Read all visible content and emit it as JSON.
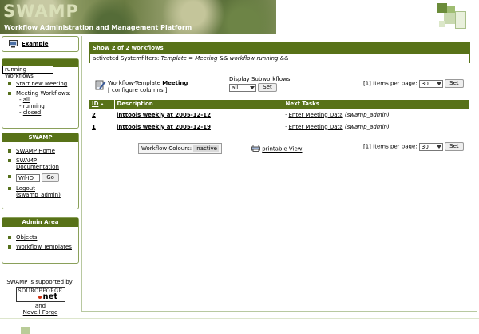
{
  "header": {
    "logo_text": "SWAMP",
    "title": "Workflow Administration and Management Platform"
  },
  "sidebar": {
    "example_link": "Example",
    "workflow_select": "running Workflows",
    "start_new_meeting": "Start new Meeting",
    "meeting_workflows_label": "Meeting Workflows:",
    "meeting_filters": [
      "all",
      "running",
      "closed"
    ],
    "swamp_section": {
      "title": "SWAMP",
      "home": "SWAMP Home",
      "documentation": "SWAMP Documentation",
      "wfid_placeholder": "Wf-ID",
      "go_label": "Go",
      "logout": "Logout (swamp_admin)"
    },
    "admin_section": {
      "title": "Admin Area",
      "objects": "Objects",
      "workflow_templates": "Workflow Templates"
    },
    "supported_by": "SWAMP is supported by:",
    "sourceforge_text": "SOURCEFORGE",
    "sourceforge_net": "net",
    "and_text": "and",
    "novell_forge": "Novell Forge"
  },
  "main": {
    "header_title": "Show 2 of 2 workflows",
    "filter_prefix": "activated Systemfilters:",
    "filter_value": "Template = Meeting && workflow running &&",
    "template_label": "Workflow-Template",
    "template_name": "Meeting",
    "configure_columns": "configure columns",
    "display_subworkflows_label": "Display Subworkflows:",
    "subworkflows_value": "all",
    "set_label": "Set",
    "page_indicator": "[1] Items per page:",
    "items_per_page": "30",
    "columns": [
      "ID",
      "Description",
      "Next Tasks"
    ],
    "rows": [
      {
        "id": "2",
        "description": "inttools weekly at 2005-12-12",
        "task": "Enter Meeting Data",
        "user": "(swamp_admin)"
      },
      {
        "id": "1",
        "description": "inttools weekly at 2005-12-19",
        "task": "Enter Meeting Data",
        "user": "(swamp_admin)"
      }
    ],
    "workflow_colours_label": "Workflow Colours:",
    "workflow_colours_value": "inactive",
    "printable_view": "printable View"
  },
  "colors": {
    "accent": "#587218",
    "banner_text": "#ffffff"
  }
}
